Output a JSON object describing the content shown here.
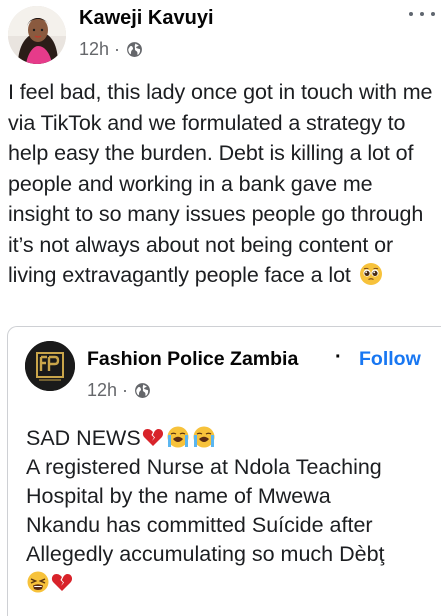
{
  "post": {
    "author": "Kaweji Kavuyi",
    "time": "12h",
    "separator": "·",
    "privacy_icon": "globe-icon",
    "more_icon": "more-options-icon",
    "text": "I feel bad, this lady once got in touch with me via TikTok and we formulated a strategy to help easy the burden. Debt is killing a lot of people and working in a bank gave me insight to so many issues people go through it’s not always about not being content or living extravagantly people face a lot",
    "text_emoji": "pleading-face-emoji"
  },
  "shared": {
    "page_name": "Fashion Police Zambia",
    "separator": "·",
    "follow_label": "Follow",
    "time": "12h",
    "privacy_icon": "globe-icon",
    "lines": {
      "l1": "SAD NEWS",
      "l2": "A registered Nurse at Ndola Teaching",
      "l3": "Hospital by the name of Mwewa",
      "l4": "Nkandu has committed Suícide after",
      "l5": "Allegedly accumulating so much Dèbţ"
    },
    "emojis": [
      "broken-heart-emoji",
      "crying-face-emoji",
      "crying-face-emoji",
      "tired-face-emoji",
      "broken-heart-emoji"
    ]
  },
  "colors": {
    "text": "#1c1e21",
    "meta": "#65676b",
    "link": "#1877f2",
    "border": "#ced0d4"
  }
}
